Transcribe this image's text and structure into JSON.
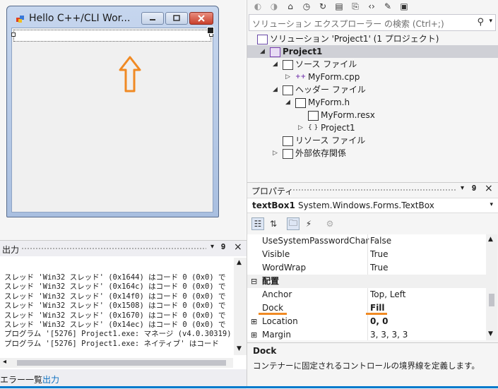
{
  "form_designer": {
    "window_title": "Hello C++/CLI Wor...",
    "arrow_color": "#f08a24"
  },
  "output": {
    "title": "出力",
    "lines": [
      "スレッド 'Win32 スレッド' (0x1644) はコード 0 (0x0) で",
      "スレッド 'Win32 スレッド' (0x164c) はコード 0 (0x0) で",
      "スレッド 'Win32 スレッド' (0x14f0) はコード 0 (0x0) で",
      "スレッド 'Win32 スレッド' (0x1508) はコード 0 (0x0) で",
      "スレッド 'Win32 スレッド' (0x1670) はコード 0 (0x0) で",
      "スレッド 'Win32 スレッド' (0x14ec) はコード 0 (0x0) で",
      "プログラム '[5276] Project1.exe: マネージ (v4.0.30319)",
      "プログラム '[5276] Project1.exe: ネイティブ' はコード"
    ],
    "tabs": [
      {
        "label": "エラー一覧",
        "active": false
      },
      {
        "label": "出力",
        "active": true
      }
    ]
  },
  "solution_explorer": {
    "search_placeholder": "ソリューション エクスプローラー の検索 (Ctrl+;)",
    "toolbar_icons": [
      "back-icon",
      "forward-icon",
      "home-icon",
      "history-icon",
      "refresh-icon",
      "collapse-all-icon",
      "show-all-files-icon",
      "view-code-icon",
      "properties-icon",
      "preview-icon"
    ],
    "tree": [
      {
        "label": "ソリューション 'Project1' (1 プロジェクト)",
        "level": 0,
        "expander": "",
        "icon": "solution-icon",
        "bold": false,
        "selected": false
      },
      {
        "label": "Project1",
        "level": 1,
        "expander": "◢",
        "icon": "project-icon",
        "bold": true,
        "selected": true
      },
      {
        "label": "ソース ファイル",
        "level": 2,
        "expander": "◢",
        "icon": "folder-icon",
        "bold": false,
        "selected": false
      },
      {
        "label": "MyForm.cpp",
        "level": 3,
        "expander": "▷",
        "icon": "cpp-file-icon",
        "bold": false,
        "selected": false
      },
      {
        "label": "ヘッダー ファイル",
        "level": 2,
        "expander": "◢",
        "icon": "folder-icon",
        "bold": false,
        "selected": false
      },
      {
        "label": "MyForm.h",
        "level": 3,
        "expander": "◢",
        "icon": "form-file-icon",
        "bold": false,
        "selected": false
      },
      {
        "label": "MyForm.resx",
        "level": 4,
        "expander": "",
        "icon": "resx-file-icon",
        "bold": false,
        "selected": false
      },
      {
        "label": "Project1",
        "level": 4,
        "expander": "▷",
        "icon": "namespace-icon",
        "bold": false,
        "selected": false
      },
      {
        "label": "リソース ファイル",
        "level": 2,
        "expander": "",
        "icon": "folder-icon",
        "bold": false,
        "selected": false
      },
      {
        "label": "外部依存関係",
        "level": 2,
        "expander": "▷",
        "icon": "folder-icon",
        "bold": false,
        "selected": false
      }
    ]
  },
  "properties": {
    "title": "プロパティ",
    "object_name": "textBox1",
    "object_type": "System.Windows.Forms.TextBox",
    "rows": [
      {
        "name": "UseSystemPasswordChar",
        "value": "False",
        "category": false,
        "bold": false,
        "plus": false
      },
      {
        "name": "Visible",
        "value": "True",
        "category": false,
        "bold": false,
        "plus": false
      },
      {
        "name": "WordWrap",
        "value": "True",
        "category": false,
        "bold": false,
        "plus": false
      },
      {
        "name": "配置",
        "value": "",
        "category": true,
        "bold": false,
        "plus": false
      },
      {
        "name": "Anchor",
        "value": "Top, Left",
        "category": false,
        "bold": false,
        "plus": false
      },
      {
        "name": "Dock",
        "value": "Fill",
        "category": false,
        "bold": true,
        "plus": false
      },
      {
        "name": "Location",
        "value": "0, 0",
        "category": false,
        "bold": true,
        "plus": true
      },
      {
        "name": "Margin",
        "value": "3, 3, 3, 3",
        "category": false,
        "bold": false,
        "plus": true
      }
    ],
    "desc_title": "Dock",
    "desc_text": "コンテナーに固定されるコントロールの境界線を定義します。",
    "highlight_color": "#f08a24"
  }
}
